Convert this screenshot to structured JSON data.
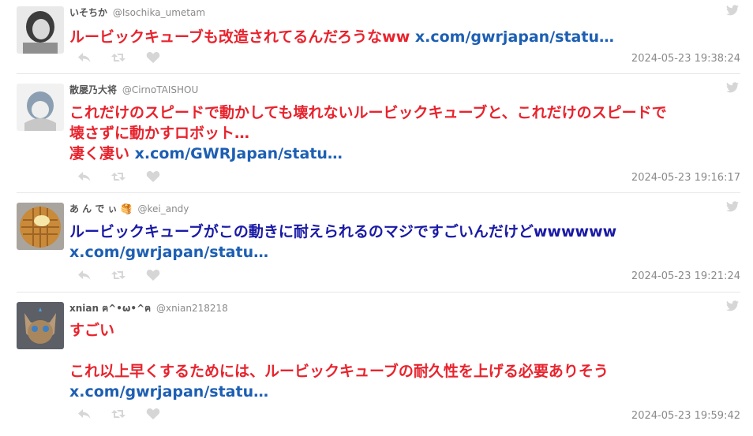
{
  "tweets": [
    {
      "display_name": "いそちか",
      "handle": "@Isochika_umetam",
      "lines": [
        [
          {
            "text": "ルービックキューブも改造されてるんだろうなww ",
            "style": "red"
          },
          {
            "text": "x.com/gwrjapan/statu…",
            "style": "link"
          }
        ]
      ],
      "timestamp": "2024-05-23 19:38:24"
    },
    {
      "display_name": "散屡乃大将",
      "handle": "@CirnoTAISHOU",
      "lines": [
        [
          {
            "text": "これだけのスピードで動かしても壊れないルービックキューブと、これだけのスピードで",
            "style": "red"
          }
        ],
        [
          {
            "text": "壊さずに動かすロボット…",
            "style": "red"
          }
        ],
        [
          {
            "text": "凄く凄い ",
            "style": "red"
          },
          {
            "text": "x.com/GWRJapan/statu…",
            "style": "link"
          }
        ]
      ],
      "timestamp": "2024-05-23 19:16:17"
    },
    {
      "display_name": "あ ん で ぃ 🥞",
      "handle": "@kei_andy",
      "lines": [
        [
          {
            "text": "ルービックキューブがこの動きに耐えられるのマジですごいんだけどwwwwww",
            "style": "blue"
          }
        ],
        [
          {
            "text": "x.com/gwrjapan/statu…",
            "style": "link"
          }
        ]
      ],
      "timestamp": "2024-05-23 19:21:24"
    },
    {
      "display_name": "xnian ฅ^•ω•^ฅ",
      "handle": "@xnian218218",
      "lines": [
        [
          {
            "text": "すごい",
            "style": "red"
          }
        ],
        [],
        [
          {
            "text": "これ以上早くするためには、ルービックキューブの耐久性を上げる必要ありそう",
            "style": "red"
          }
        ],
        [
          {
            "text": "x.com/gwrjapan/statu…",
            "style": "link"
          }
        ]
      ],
      "timestamp": "2024-05-23 19:59:42"
    }
  ],
  "icons": {
    "brand": "twitter-bird-icon",
    "reply": "reply-icon",
    "retweet": "retweet-icon",
    "like": "heart-icon"
  },
  "colors": {
    "text_red": "#e8232d",
    "text_blue": "#1a1aa6",
    "link": "#1d5fb3",
    "muted": "#8a8a8a",
    "icon": "#d6d6d6",
    "divider": "#e6e6e6"
  }
}
